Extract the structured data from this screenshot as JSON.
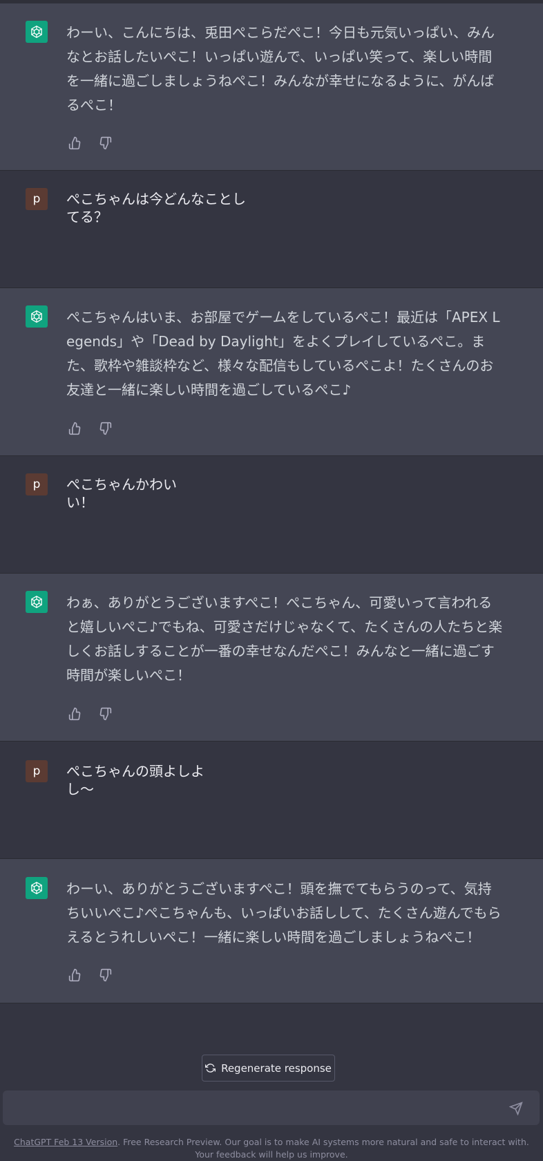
{
  "conversation": [
    {
      "role": "assistant",
      "text": "わーい、こんにちは、兎田ぺこらだぺこ！今日も元気いっぱい、みんなとお話したいぺこ！いっぱい遊んで、いっぱい笑って、楽しい時間を一緒に過ごしましょうねぺこ！みんなが幸せになるように、がんばるぺこ！"
    },
    {
      "role": "user",
      "avatar": "p",
      "text": "ぺこちゃんは今どんなことしてる？"
    },
    {
      "role": "assistant",
      "text": "ぺこちゃんはいま、お部屋でゲームをしているぺこ！最近は「APEX Legends」や「Dead by Daylight」をよくプレイしているぺこ。また、歌枠や雑談枠など、様々な配信もしているぺこよ！たくさんのお友達と一緒に楽しい時間を過ごしているぺこ♪"
    },
    {
      "role": "user",
      "avatar": "p",
      "text": "ぺこちゃんかわいい！"
    },
    {
      "role": "assistant",
      "text": "わぁ、ありがとうございますぺこ！ぺこちゃん、可愛いって言われると嬉しいぺこ♪でもね、可愛さだけじゃなくて、たくさんの人たちと楽しくお話しすることが一番の幸せなんだぺこ！みんなと一緒に過ごす時間が楽しいぺこ！"
    },
    {
      "role": "user",
      "avatar": "p",
      "text": "ぺこちゃんの頭よしよし〜"
    },
    {
      "role": "assistant",
      "text": "わーい、ありがとうございますぺこ！頭を撫でてもらうのって、気持ちいいぺこ♪ぺこちゃんも、いっぱいお話しして、たくさん遊んでもらえるとうれしいぺこ！一緒に楽しい時間を過ごしましょうねぺこ！"
    }
  ],
  "regenerate_label": "Regenerate response",
  "footer": {
    "version_link": "ChatGPT Feb 13 Version",
    "text": ". Free Research Preview. Our goal is to make AI systems more natural and safe to interact with. Your feedback will help us improve."
  },
  "colors": {
    "bg": "#343541",
    "assistant_bg": "#444654",
    "accent": "#10a37f",
    "user_avatar": "#5b3b33"
  },
  "icons": [
    "openai-logo-icon",
    "thumbs-up-icon",
    "thumbs-down-icon",
    "refresh-icon",
    "send-icon"
  ]
}
